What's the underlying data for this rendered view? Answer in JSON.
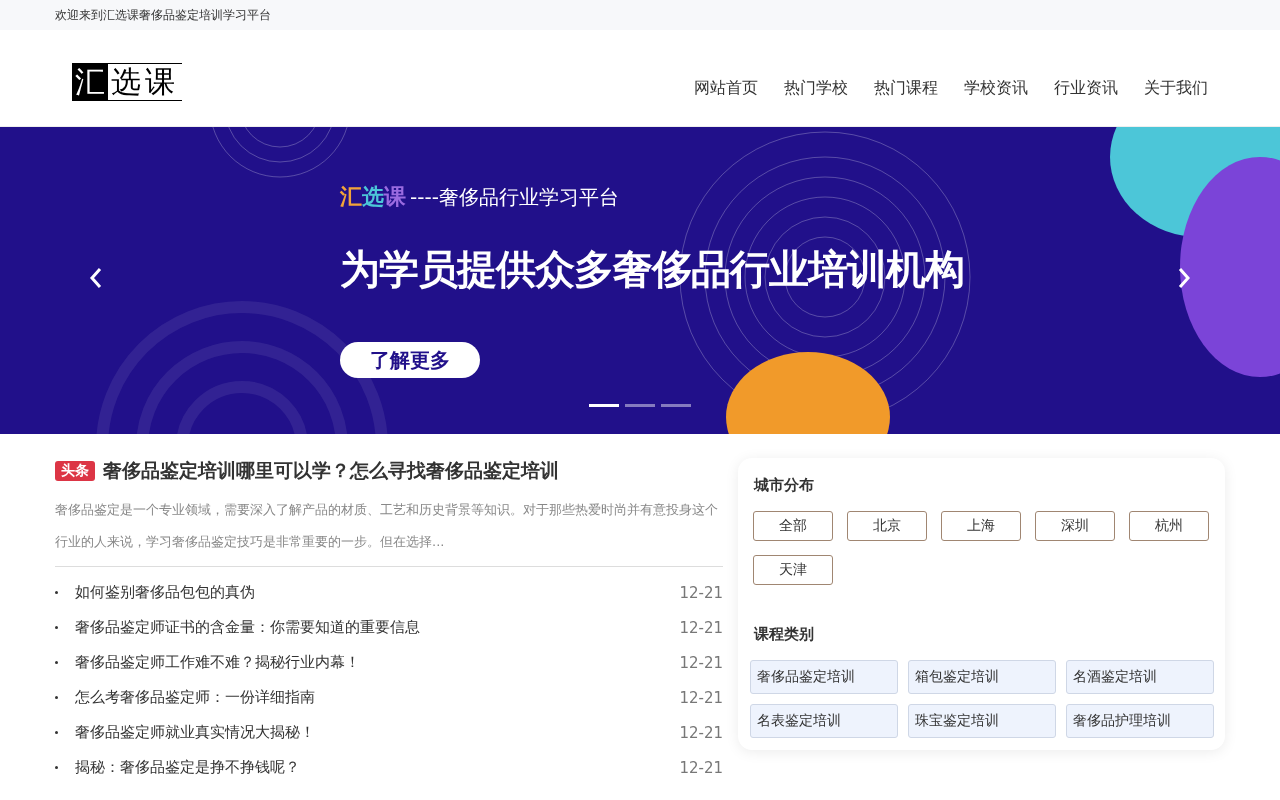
{
  "top_bar": {
    "welcome": "欢迎来到汇选课奢侈品鉴定培训学习平台"
  },
  "header": {
    "logo": {
      "boxed": "汇",
      "rest": "选课"
    },
    "nav": [
      {
        "label": "网站首页"
      },
      {
        "label": "热门学校"
      },
      {
        "label": "热门课程"
      },
      {
        "label": "学校资讯"
      },
      {
        "label": "行业资讯"
      },
      {
        "label": "关于我们"
      }
    ]
  },
  "banner": {
    "brand": "汇选课",
    "tagline": "----奢侈品行业学习平台",
    "headline": "为学员提供众多奢侈品行业培训机构",
    "button": "了解更多",
    "indicators": [
      {
        "selected": true
      },
      {
        "selected": false
      },
      {
        "selected": false
      }
    ]
  },
  "headline_article": {
    "badge": "头条",
    "title": "奢侈品鉴定培训哪里可以学？怎么寻找奢侈品鉴定培训",
    "summary": "奢侈品鉴定是一个专业领域，需要深入了解产品的材质、工艺和历史背景等知识。对于那些热爱时尚并有意投身这个行业的人来说，学习奢侈品鉴定技巧是非常重要的一步。但在选择..."
  },
  "news": [
    {
      "title": "如何鉴别奢侈品包包的真伪",
      "date": "12-21"
    },
    {
      "title": "奢侈品鉴定师证书的含金量：你需要知道的重要信息",
      "date": "12-21"
    },
    {
      "title": "奢侈品鉴定师工作难不难？揭秘行业内幕！",
      "date": "12-21"
    },
    {
      "title": "怎么考奢侈品鉴定师：一份详细指南",
      "date": "12-21"
    },
    {
      "title": "奢侈品鉴定师就业真实情况大揭秘！",
      "date": "12-21"
    },
    {
      "title": "揭秘：奢侈品鉴定是挣不挣钱呢？",
      "date": "12-21"
    }
  ],
  "sidebar": {
    "city_title": "城市分布",
    "cities": [
      "全部",
      "北京",
      "上海",
      "深圳",
      "杭州",
      "天津"
    ],
    "category_title": "课程类别",
    "categories": [
      "奢侈品鉴定培训",
      "箱包鉴定培训",
      "名酒鉴定培训",
      "名表鉴定培训",
      "珠宝鉴定培训",
      "奢侈品护理培训"
    ]
  }
}
